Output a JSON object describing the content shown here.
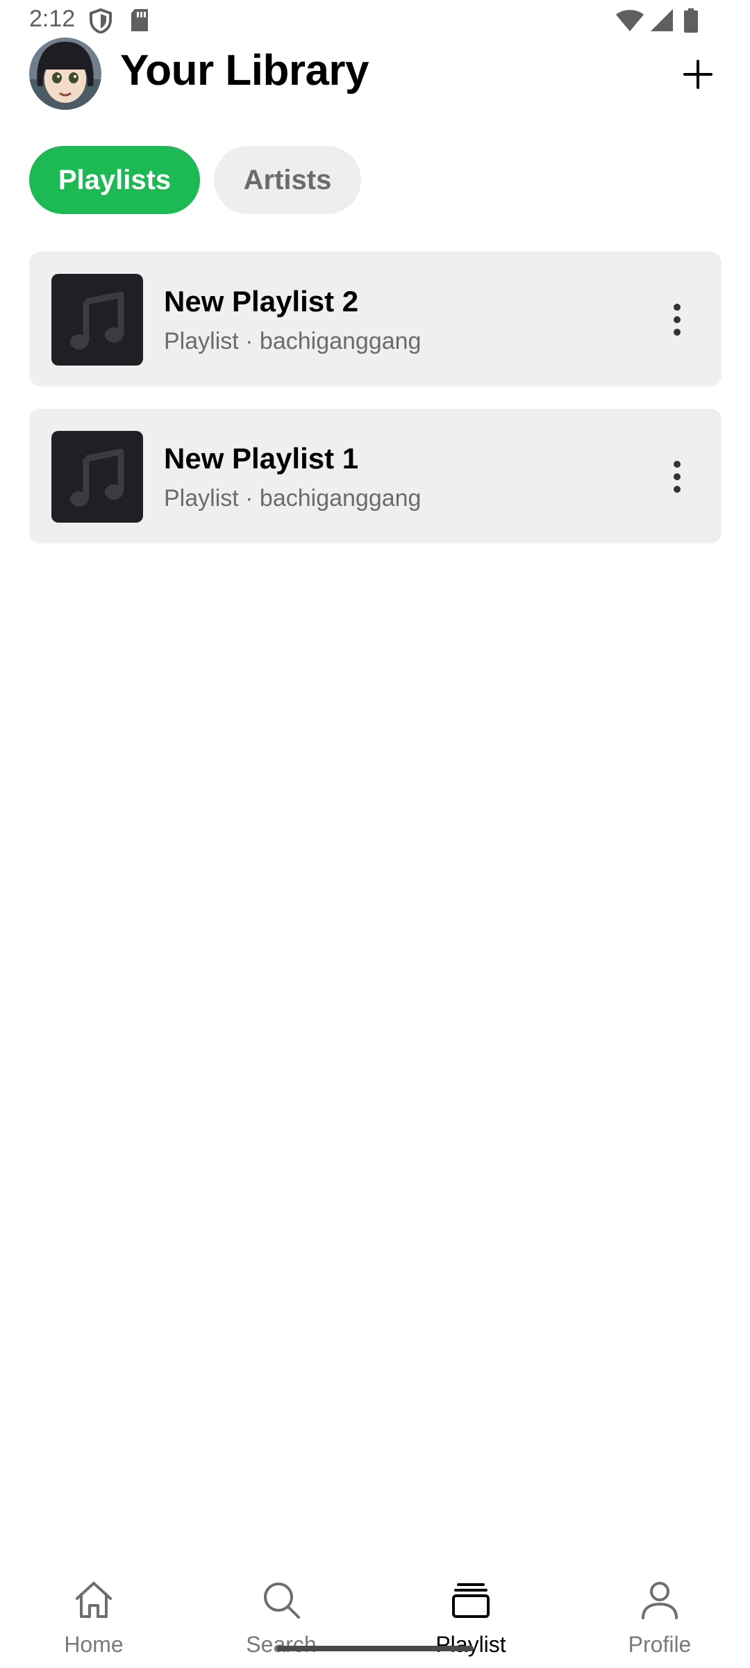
{
  "status_bar": {
    "time": "2:12"
  },
  "header": {
    "title": "Your Library"
  },
  "filters": [
    {
      "label": "Playlists",
      "active": true
    },
    {
      "label": "Artists",
      "active": false
    }
  ],
  "playlists": [
    {
      "title": "New Playlist 2",
      "subtitle": "Playlist · bachiganggang"
    },
    {
      "title": "New Playlist 1",
      "subtitle": "Playlist · bachiganggang"
    }
  ],
  "bottom_nav": [
    {
      "label": "Home",
      "icon": "home-icon",
      "active": false
    },
    {
      "label": "Search",
      "icon": "search-icon",
      "active": false
    },
    {
      "label": "Playlist",
      "icon": "playlist-icon",
      "active": true
    },
    {
      "label": "Profile",
      "icon": "profile-icon",
      "active": false
    }
  ],
  "colors": {
    "accent": "#1db954",
    "card_bg": "#efefef",
    "chip_inactive_bg": "#eeeeee",
    "thumb_bg": "#1f2023"
  }
}
